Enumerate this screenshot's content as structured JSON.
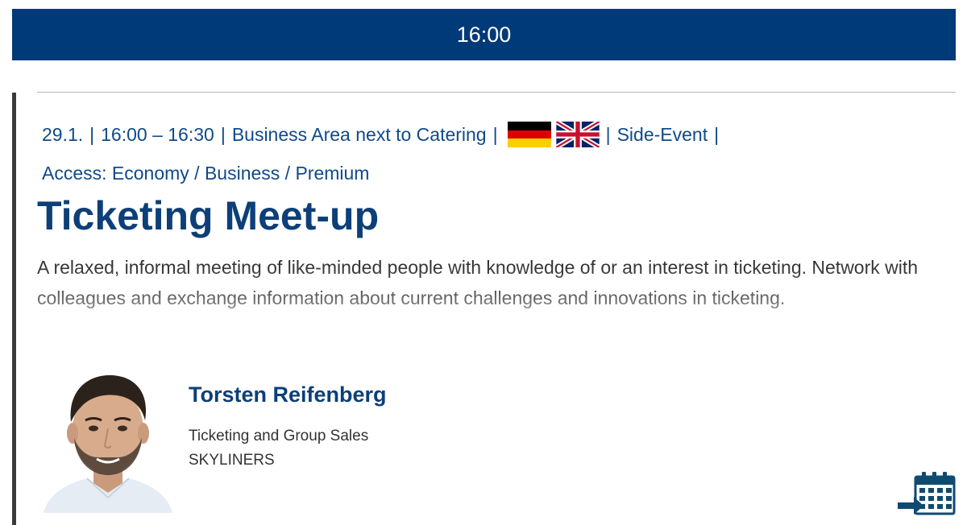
{
  "header": {
    "time": "16:00"
  },
  "session": {
    "date": "29.1.",
    "time_range": "16:00 – 16:30",
    "location": "Business Area next to Catering",
    "languages": [
      "german-flag-icon",
      "uk-flag-icon"
    ],
    "type": "Side-Event",
    "access": "Access: Economy / Business / Premium",
    "title": "Ticketing Meet-up",
    "description": "A relaxed, informal meeting of like-minded people with knowledge of or an interest in ticketing. Network with colleagues and exchange information about current challenges and innovations in ticketing."
  },
  "speaker": {
    "name": "Torsten Reifenberg",
    "role": "Ticketing and Group Sales",
    "company": "SKYLINERS"
  },
  "actions": {
    "add_to_calendar_icon": "calendar-add-icon"
  },
  "colors": {
    "header_bg": "#003a78",
    "accent": "#0d3f78",
    "meta_text": "#0f4a8a",
    "left_bar": "#3a3a3a"
  }
}
